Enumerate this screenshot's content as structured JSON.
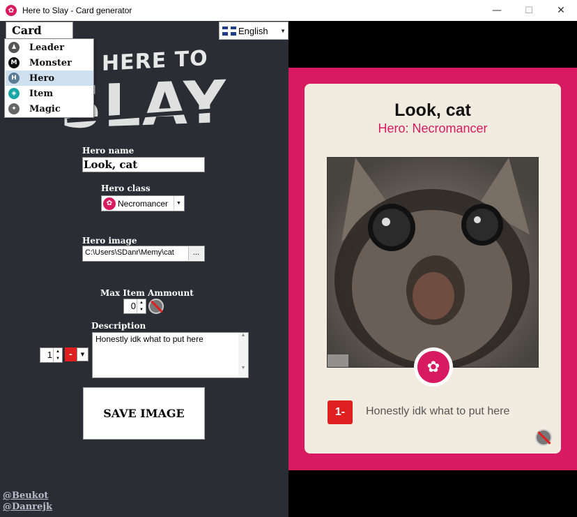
{
  "window": {
    "title": "Here to Slay - Card generator",
    "minimize": "—",
    "maximize": "☐",
    "close": "✕"
  },
  "logo": {
    "line1": "HERE TO",
    "line2": "SLAY"
  },
  "card_type": {
    "header": "Card Type",
    "items": [
      {
        "label": "Leader",
        "icon": "leader-icon",
        "color": "#555555",
        "glyph": "♟"
      },
      {
        "label": "Monster",
        "icon": "monster-icon",
        "color": "#111111",
        "glyph": "M"
      },
      {
        "label": "Hero",
        "icon": "hero-icon",
        "color": "#5a7c96",
        "glyph": "H",
        "selected": true
      },
      {
        "label": "Item",
        "icon": "item-icon",
        "color": "#1aa6a6",
        "glyph": "◈"
      },
      {
        "label": "Magic",
        "icon": "magic-icon",
        "color": "#666666",
        "glyph": "✦"
      }
    ]
  },
  "language": {
    "selected": "English"
  },
  "form": {
    "hero_name_label": "Hero name",
    "hero_name_value": "Look, cat",
    "hero_class_label": "Hero class",
    "hero_class_value": "Necromancer",
    "hero_image_label": "Hero image",
    "hero_image_path": "C:\\Users\\SDanr\\Memy\\cat",
    "browse": "...",
    "max_item_label": "Max Item Ammount",
    "max_item_value": "0",
    "description_label": "Description",
    "description_value": "Honestly idk what to put here",
    "roll_value": "1",
    "roll_sign": "-",
    "save_label": "SAVE IMAGE"
  },
  "credits": [
    "@Beukot",
    "@Danrejk"
  ],
  "card": {
    "title": "Look, cat",
    "subtitle": "Hero: Necromancer",
    "roll": "1-",
    "description": "Honestly idk what to put here",
    "accent": "#d81b60"
  }
}
